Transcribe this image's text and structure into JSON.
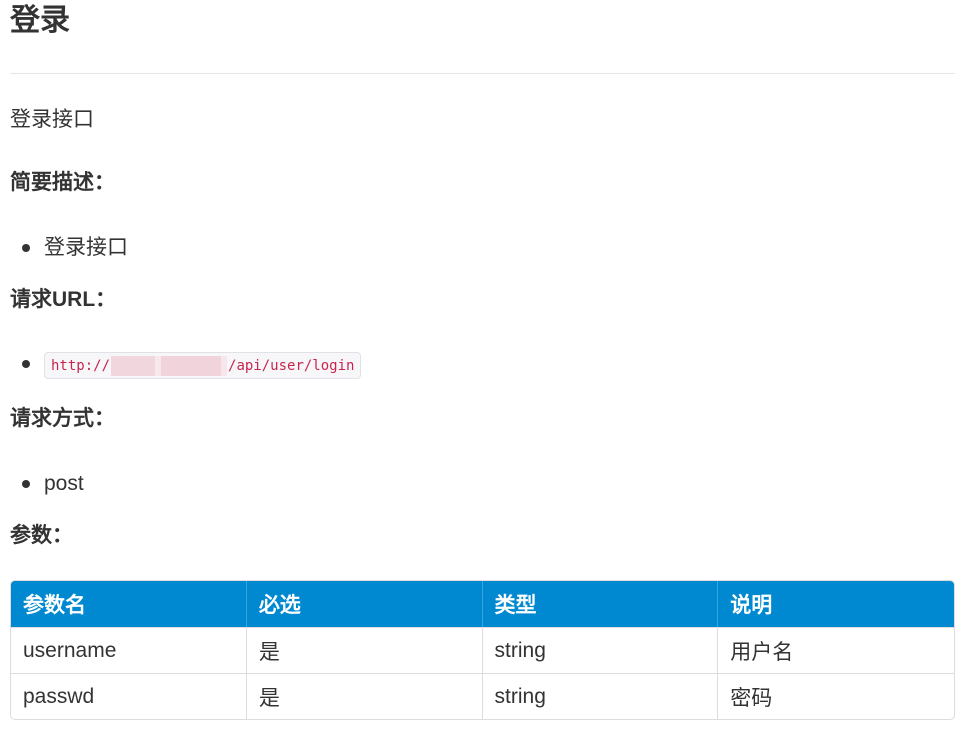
{
  "title": "登录",
  "intro": "登录接口",
  "sections": {
    "summary": {
      "heading": "简要描述：",
      "item": "登录接口"
    },
    "url": {
      "heading": "请求URL：",
      "prefix": "http://",
      "suffix": "/api/user/login"
    },
    "method": {
      "heading": "请求方式：",
      "item": "post"
    },
    "params": {
      "heading": "参数："
    }
  },
  "table": {
    "headers": [
      "参数名",
      "必选",
      "类型",
      "说明"
    ],
    "rows": [
      [
        "username",
        "是",
        "string",
        "用户名"
      ],
      [
        "passwd",
        "是",
        "string",
        "密码"
      ]
    ]
  },
  "colors": {
    "table_header_bg": "#0089d0",
    "code_text": "#c7254e"
  }
}
